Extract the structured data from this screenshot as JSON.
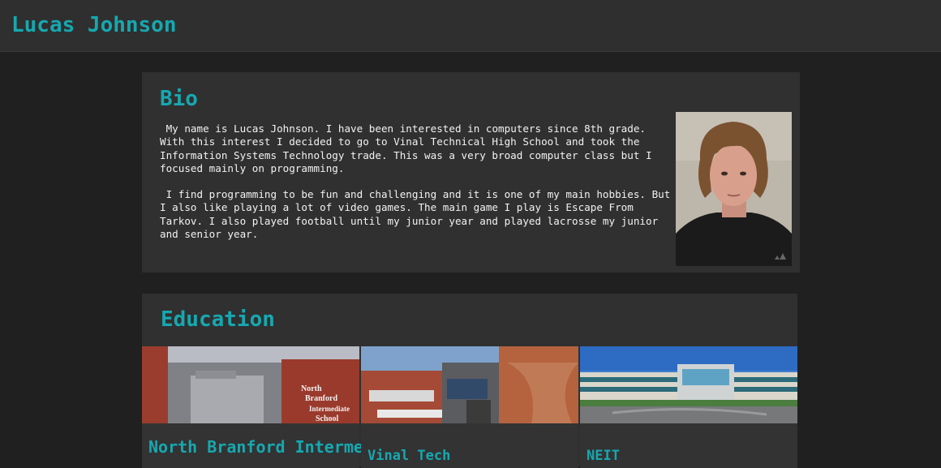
{
  "header": {
    "title": "Lucas Johnson"
  },
  "bio": {
    "heading": "Bio",
    "paragraphs": [
      " My name is Lucas Johnson. I have been interested in computers since 8th grade. With this interest I decided to go to Vinal Technical High School and took the Information Systems Technology trade. This was a very broad computer class but I focused mainly on programming.",
      " I find programming to be fun and challenging and it is one of my main hobbies. But I also like playing a lot of video games. The main game I play is Escape From Tarkov. I also played football until my junior year and played lacrosse my junior and senior year."
    ]
  },
  "education": {
    "heading": "Education",
    "schools": [
      {
        "name": "North Branford Intermediate School",
        "sign": [
          "North",
          "Branford",
          "Intermediate",
          "School"
        ]
      },
      {
        "name": "Vinal Tech"
      },
      {
        "name": "NEIT"
      }
    ]
  },
  "colors": {
    "accent": "#16a8b0",
    "background": "#202020",
    "card": "#303030"
  }
}
